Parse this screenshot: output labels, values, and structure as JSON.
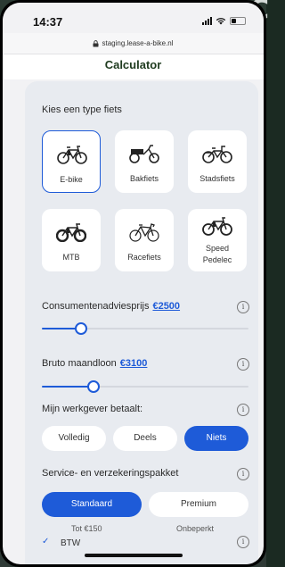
{
  "status": {
    "time": "14:37"
  },
  "browser": {
    "url": "staging.lease-a-bike.nl"
  },
  "page": {
    "title": "Calculator"
  },
  "bike_type": {
    "label": "Kies een type fiets",
    "tiles": [
      {
        "label": "E-bike",
        "icon": "e-bike-icon",
        "selected": true
      },
      {
        "label": "Bakfiets",
        "icon": "cargo-bike-icon",
        "selected": false
      },
      {
        "label": "Stadsfiets",
        "icon": "city-bike-icon",
        "selected": false
      },
      {
        "label": "MTB",
        "icon": "mtb-icon",
        "selected": false
      },
      {
        "label": "Racefiets",
        "icon": "race-bike-icon",
        "selected": false
      },
      {
        "label_line1": "Speed",
        "label_line2": "Pedelec",
        "icon": "speed-pedelec-icon",
        "selected": false
      }
    ]
  },
  "price": {
    "label": "Consumentenadviesprijs",
    "value": "€2500",
    "slider_fraction": 0.19
  },
  "salary": {
    "label": "Bruto maandloon",
    "value": "€3100",
    "slider_fraction": 0.25
  },
  "employer": {
    "label": "Mijn werkgever betaalt:",
    "options": [
      "Volledig",
      "Deels",
      "Niets"
    ],
    "selected": "Niets"
  },
  "package": {
    "label": "Service- en verzekeringspakket",
    "options": [
      "Standaard",
      "Premium"
    ],
    "selected": "Standaard",
    "notes": [
      "Tot €150",
      "Onbeperkt"
    ]
  },
  "vat": {
    "label": "BTW",
    "checked": true
  },
  "colors": {
    "accent": "#1e5bd8",
    "title": "#1f3b1f",
    "card": "#e8ebf0"
  }
}
